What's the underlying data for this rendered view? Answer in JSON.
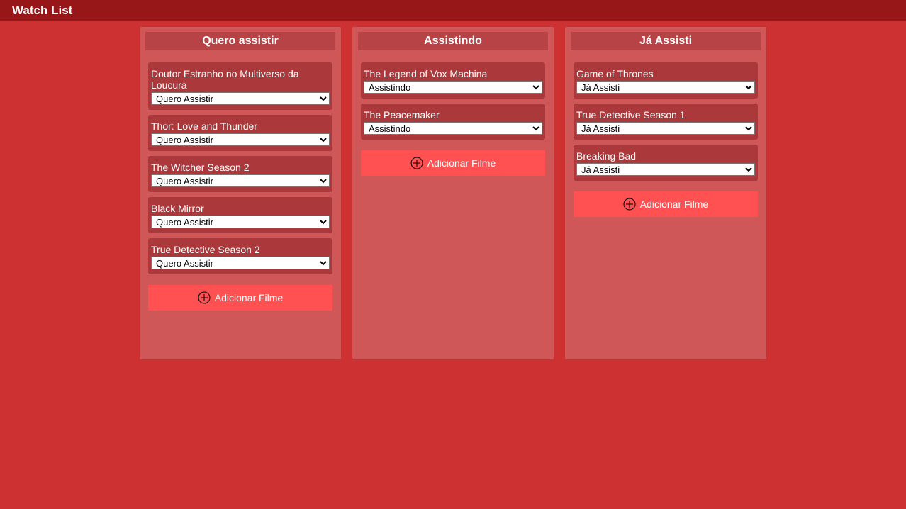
{
  "app": {
    "title": "Watch List"
  },
  "columns": [
    {
      "title": "Quero assistir",
      "cards": [
        {
          "title": "Doutor Estranho no Multiverso da Loucura",
          "status": "Quero Assistir"
        },
        {
          "title": "Thor: Love and Thunder",
          "status": "Quero Assistir"
        },
        {
          "title": "The Witcher Season 2",
          "status": "Quero Assistir"
        },
        {
          "title": "Black Mirror",
          "status": "Quero Assistir"
        },
        {
          "title": "True Detective Season 2",
          "status": "Quero Assistir"
        }
      ],
      "add_label": "Adicionar Filme"
    },
    {
      "title": "Assistindo",
      "cards": [
        {
          "title": "The Legend of Vox Machina",
          "status": "Assistindo"
        },
        {
          "title": "The Peacemaker",
          "status": "Assistindo"
        }
      ],
      "add_label": "Adicionar Filme"
    },
    {
      "title": "Já Assisti",
      "cards": [
        {
          "title": "Game of Thrones",
          "status": "Já Assisti"
        },
        {
          "title": "True Detective Season 1",
          "status": "Já Assisti"
        },
        {
          "title": "Breaking Bad",
          "status": "Já Assisti"
        }
      ],
      "add_label": "Adicionar Filme"
    }
  ],
  "status_options": [
    "Quero Assistir",
    "Assistindo",
    "Já Assisti"
  ],
  "icons": {
    "add": "plus-circle-icon"
  },
  "colors": {
    "background": "#cd3131",
    "topbar": "#971719",
    "column": "#d05757",
    "column_header": "#b84347",
    "card": "#ab383b",
    "add_button": "#ff5152"
  }
}
